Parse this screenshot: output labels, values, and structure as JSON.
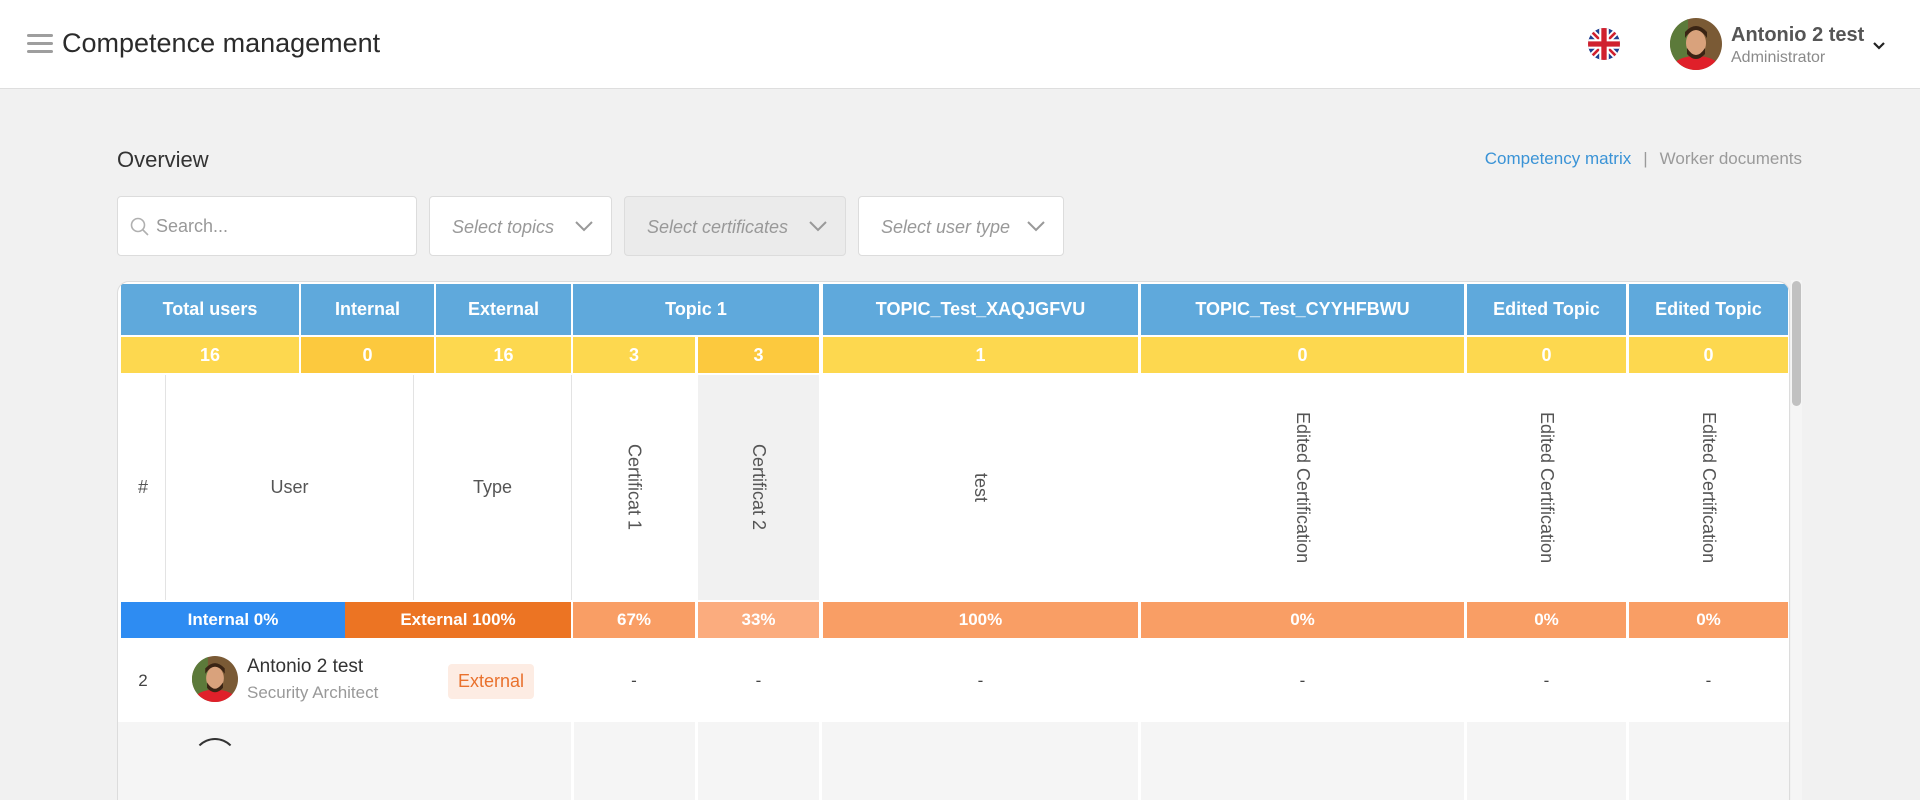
{
  "header": {
    "title": "Competence management",
    "user_name": "Antonio 2 test",
    "user_role": "Administrator",
    "language_icon": "uk-flag-icon",
    "menu_icon": "hamburger-menu-icon"
  },
  "page": {
    "title": "Overview",
    "links": {
      "matrix": "Competency matrix",
      "separator": "|",
      "docs": "Worker documents"
    }
  },
  "filters": {
    "search_placeholder": "Search...",
    "search_value": "",
    "topics": "Select topics",
    "certificates": "Select certificates",
    "user_type": "Select user type"
  },
  "matrix": {
    "group_headers": {
      "total_users": "Total users",
      "internal": "Internal",
      "external": "External",
      "topic1": "Topic 1",
      "topic_xaq": "TOPIC_Test_XAQJGFVU",
      "topic_cyy": "TOPIC_Test_CYYHFBWU",
      "edited1": "Edited Topic",
      "edited2": "Edited Topic"
    },
    "counts": {
      "total_users": "16",
      "internal": "0",
      "external": "16",
      "cert1": "3",
      "cert2": "3",
      "test": "1",
      "edited_cert1": "0",
      "edited_cert2": "0",
      "edited_cert3": "0"
    },
    "column_headers": {
      "num": "#",
      "user": "User",
      "type": "Type",
      "cert1": "Certificat 1",
      "cert2": "Certificat 2",
      "test": "test",
      "edited_cert1": "Edited Certification",
      "edited_cert2": "Edited Certification",
      "edited_cert3": "Edited Certification"
    },
    "percentages": {
      "internal": "Internal 0%",
      "external": "External 100%",
      "cert1": "67%",
      "cert2": "33%",
      "test": "100%",
      "edited_cert1": "0%",
      "edited_cert2": "0%",
      "edited_cert3": "0%"
    },
    "rows": [
      {
        "num": "2",
        "name": "Antonio 2 test",
        "job": "Security Architect",
        "type": "External",
        "cert1": "-",
        "cert2": "-",
        "test": "-",
        "edited_cert1": "-",
        "edited_cert2": "-",
        "edited_cert3": "-"
      }
    ]
  },
  "colors": {
    "accent": "#3a93d6",
    "header_blue": "#5fa9dc",
    "count_yellow": "#fdd84f",
    "internal_blue": "#2e8cf2",
    "external_orange": "#ec7423",
    "pct_orange": "#f99e65",
    "pct_light": "#fbac7e"
  }
}
